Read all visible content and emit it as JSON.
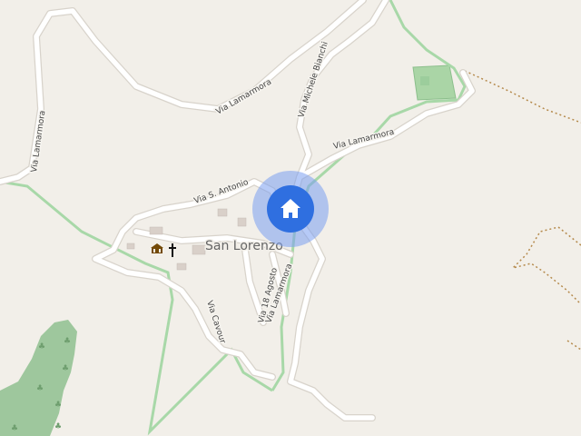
{
  "map": {
    "place_label": "San Lorenzo",
    "street_labels": {
      "lamarmora_top": "Via Lamarmora",
      "lamarmora_left": "Via Lamarmora",
      "lamarmora_right": "Via Lamarmora",
      "lamarmora_bottom": "Via Lamarmora",
      "michele_bianchi": "Via Michele Bianchi",
      "s_antonio": "Via S. Antonio",
      "cavour": "Via Cavour",
      "diciotto_agosto": "Via 18 Agosto"
    },
    "marker": {
      "icon": "home-icon",
      "color": "#2f6fe0",
      "halo_color": "#7a9ef0"
    },
    "pois": [
      {
        "name": "town-hall-icon",
        "icon": "town-hall-icon"
      },
      {
        "name": "church-icon",
        "icon": "church-icon"
      }
    ],
    "colors": {
      "background": "#f2efe9",
      "road": "#ffffff",
      "road_casing": "#d8d3cb",
      "track": "#a8d8a8",
      "forest": "#8fbf8f",
      "park": "#aad5a6",
      "boundary": "#b58a4c"
    }
  }
}
